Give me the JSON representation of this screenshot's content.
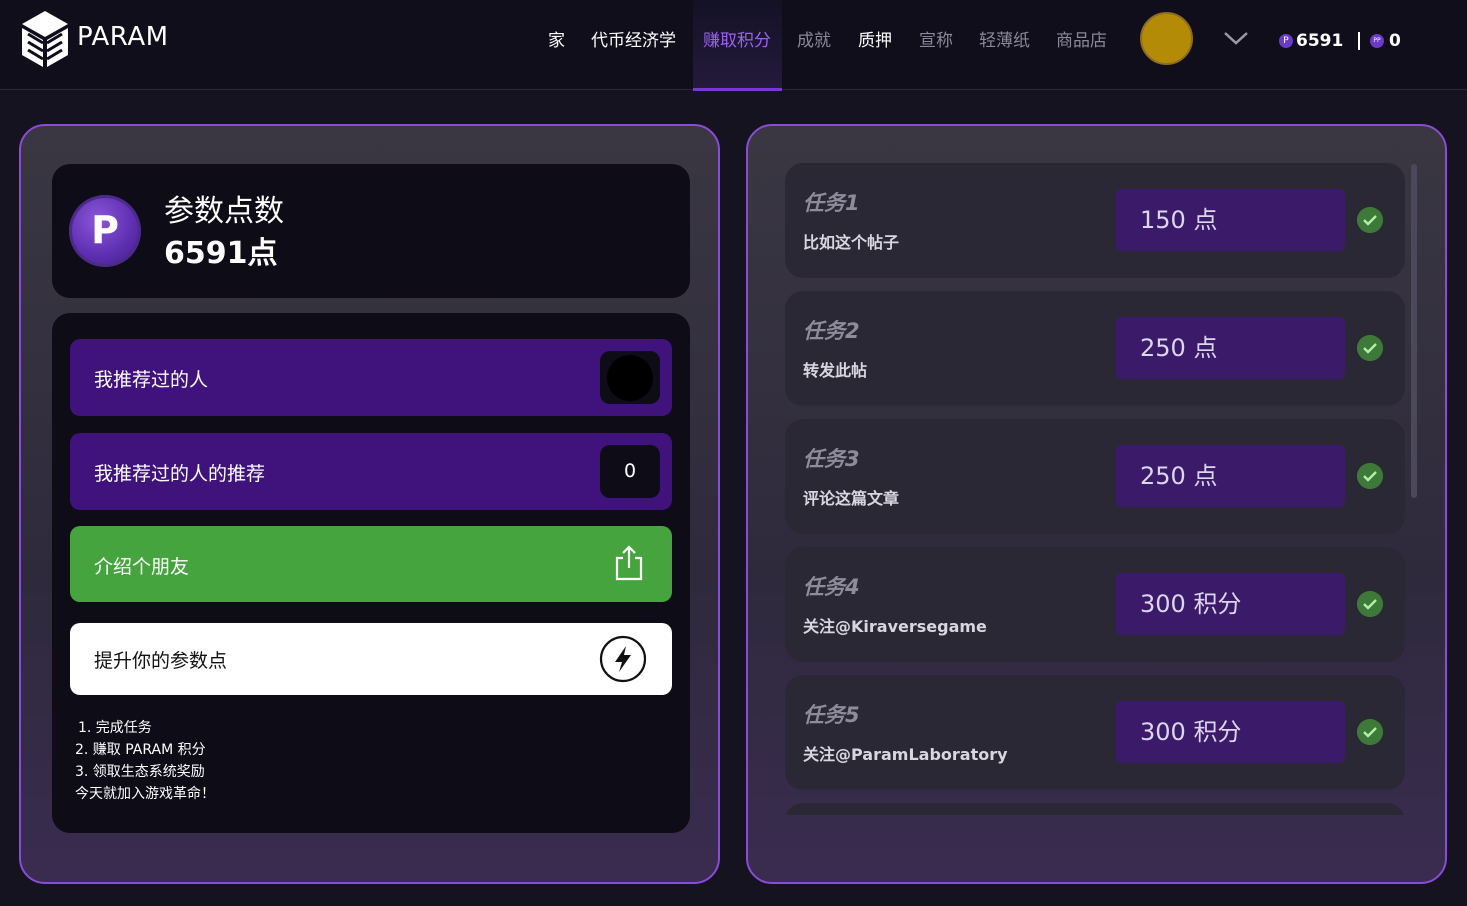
{
  "brand": {
    "name": "PARAM"
  },
  "nav": {
    "items": [
      {
        "label": "家"
      },
      {
        "label": "代币经济学"
      },
      {
        "label": "赚取积分"
      },
      {
        "label": "成就"
      },
      {
        "label": "质押"
      },
      {
        "label": "宣称"
      },
      {
        "label": "轻薄纸"
      },
      {
        "label": "商品店"
      }
    ],
    "active": "赚取积分"
  },
  "header": {
    "balance_points": "6591",
    "balance_pp": "0",
    "pp_icon_text": "PP",
    "p_icon_text": "P"
  },
  "points_card": {
    "title": "参数点数",
    "value": "6591点",
    "coin_letter": "P"
  },
  "referrals": {
    "rows": [
      {
        "label": "我推荐过的人",
        "value": ""
      },
      {
        "label": "我推荐过的人的推荐",
        "value": "0"
      }
    ],
    "invite_label": "介绍个朋友",
    "boost_label": "提升你的参数点",
    "steps": [
      "1. 完成任务",
      "2. 赚取 PARAM 积分",
      "3. 领取生态系统奖励",
      "今天就加入游戏革命！"
    ]
  },
  "tasks": [
    {
      "title": "任务1",
      "desc": "比如这个帖子",
      "points": "150 点",
      "done": true
    },
    {
      "title": "任务2",
      "desc": "转发此帖",
      "points": "250 点",
      "done": true
    },
    {
      "title": "任务3",
      "desc": "评论这篇文章",
      "points": "250 点",
      "done": true
    },
    {
      "title": "任务4",
      "desc": "关注@Kiraversegame",
      "points": "300 积分",
      "done": true
    },
    {
      "title": "任务5",
      "desc": "关注@ParamLaboratory",
      "points": "300 积分",
      "done": true
    }
  ],
  "colors": {
    "accent": "#7a37d6",
    "active_nav": "#9a62f2",
    "referral_row": "#40127c",
    "invite_green": "#45a43e",
    "avatar_gold": "#b38b07",
    "check_green": "#3d7a3a"
  }
}
